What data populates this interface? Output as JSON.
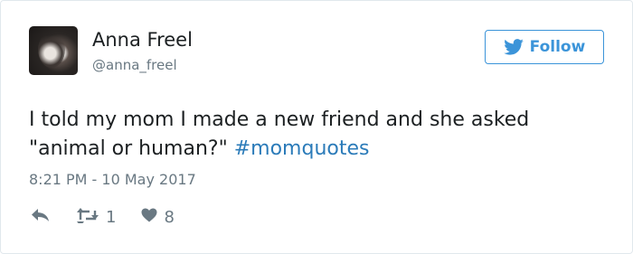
{
  "author": {
    "name": "Anna Freel",
    "handle": "@anna_freel"
  },
  "follow_button": {
    "label": "Follow"
  },
  "tweet": {
    "text_main": "I told my mom I made a new friend and she asked \"animal or human?\"",
    "hashtag": "#momquotes",
    "timestamp": "8:21 PM - 10 May 2017"
  },
  "actions": {
    "retweet_count": "1",
    "like_count": "8"
  },
  "icons": [
    "twitter-bird-icon",
    "reply-icon",
    "retweet-icon",
    "heart-icon"
  ],
  "colors": {
    "accent": "#3b94d9",
    "hashtag": "#2b7bb9",
    "muted": "#697882",
    "text": "#1c2022"
  }
}
